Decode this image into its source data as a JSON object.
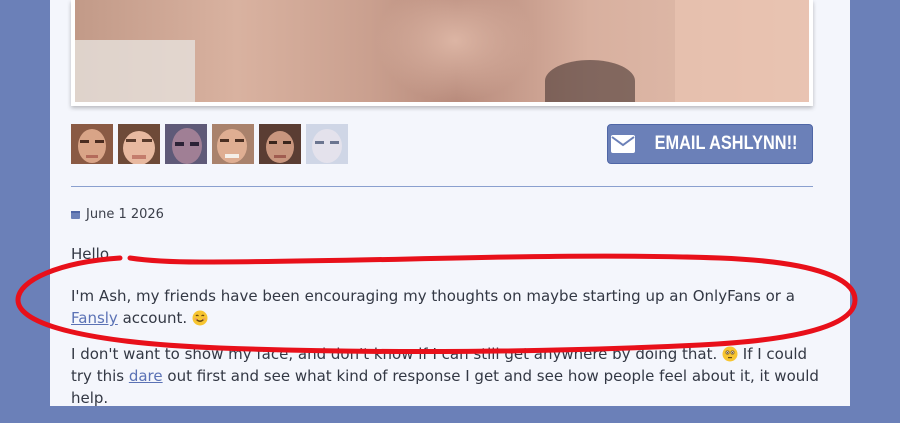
{
  "hero": {
    "image": "photo"
  },
  "thumbnails": [
    "face-thumb-1",
    "face-thumb-2",
    "face-thumb-3",
    "face-thumb-4",
    "face-thumb-5",
    "face-thumb-6"
  ],
  "email_button": {
    "icon": "envelope-icon",
    "label": "EMAIL ASHLYNN!!"
  },
  "post": {
    "date": "June 1 2026",
    "greeting": "Hello,",
    "p1_before": "I'm Ash, my friends have been encouraging my thoughts on maybe starting up an OnlyFans or a ",
    "p1_link": "Fansly",
    "p1_after": " account. ",
    "p2_before": "I don't want to show my face, and don't know if I can still get anywhere by doing that. ",
    "p2_mid": " If I could try this ",
    "p2_link": "dare",
    "p2_after": " out first and see what kind of response I get and see how people feel about it, it would help."
  },
  "colors": {
    "page_bg": "#6b80b8",
    "card_bg": "#f4f6fc",
    "button_bg": "#6b80b8",
    "link": "#5b72b5",
    "annotation": "#e8101a"
  }
}
